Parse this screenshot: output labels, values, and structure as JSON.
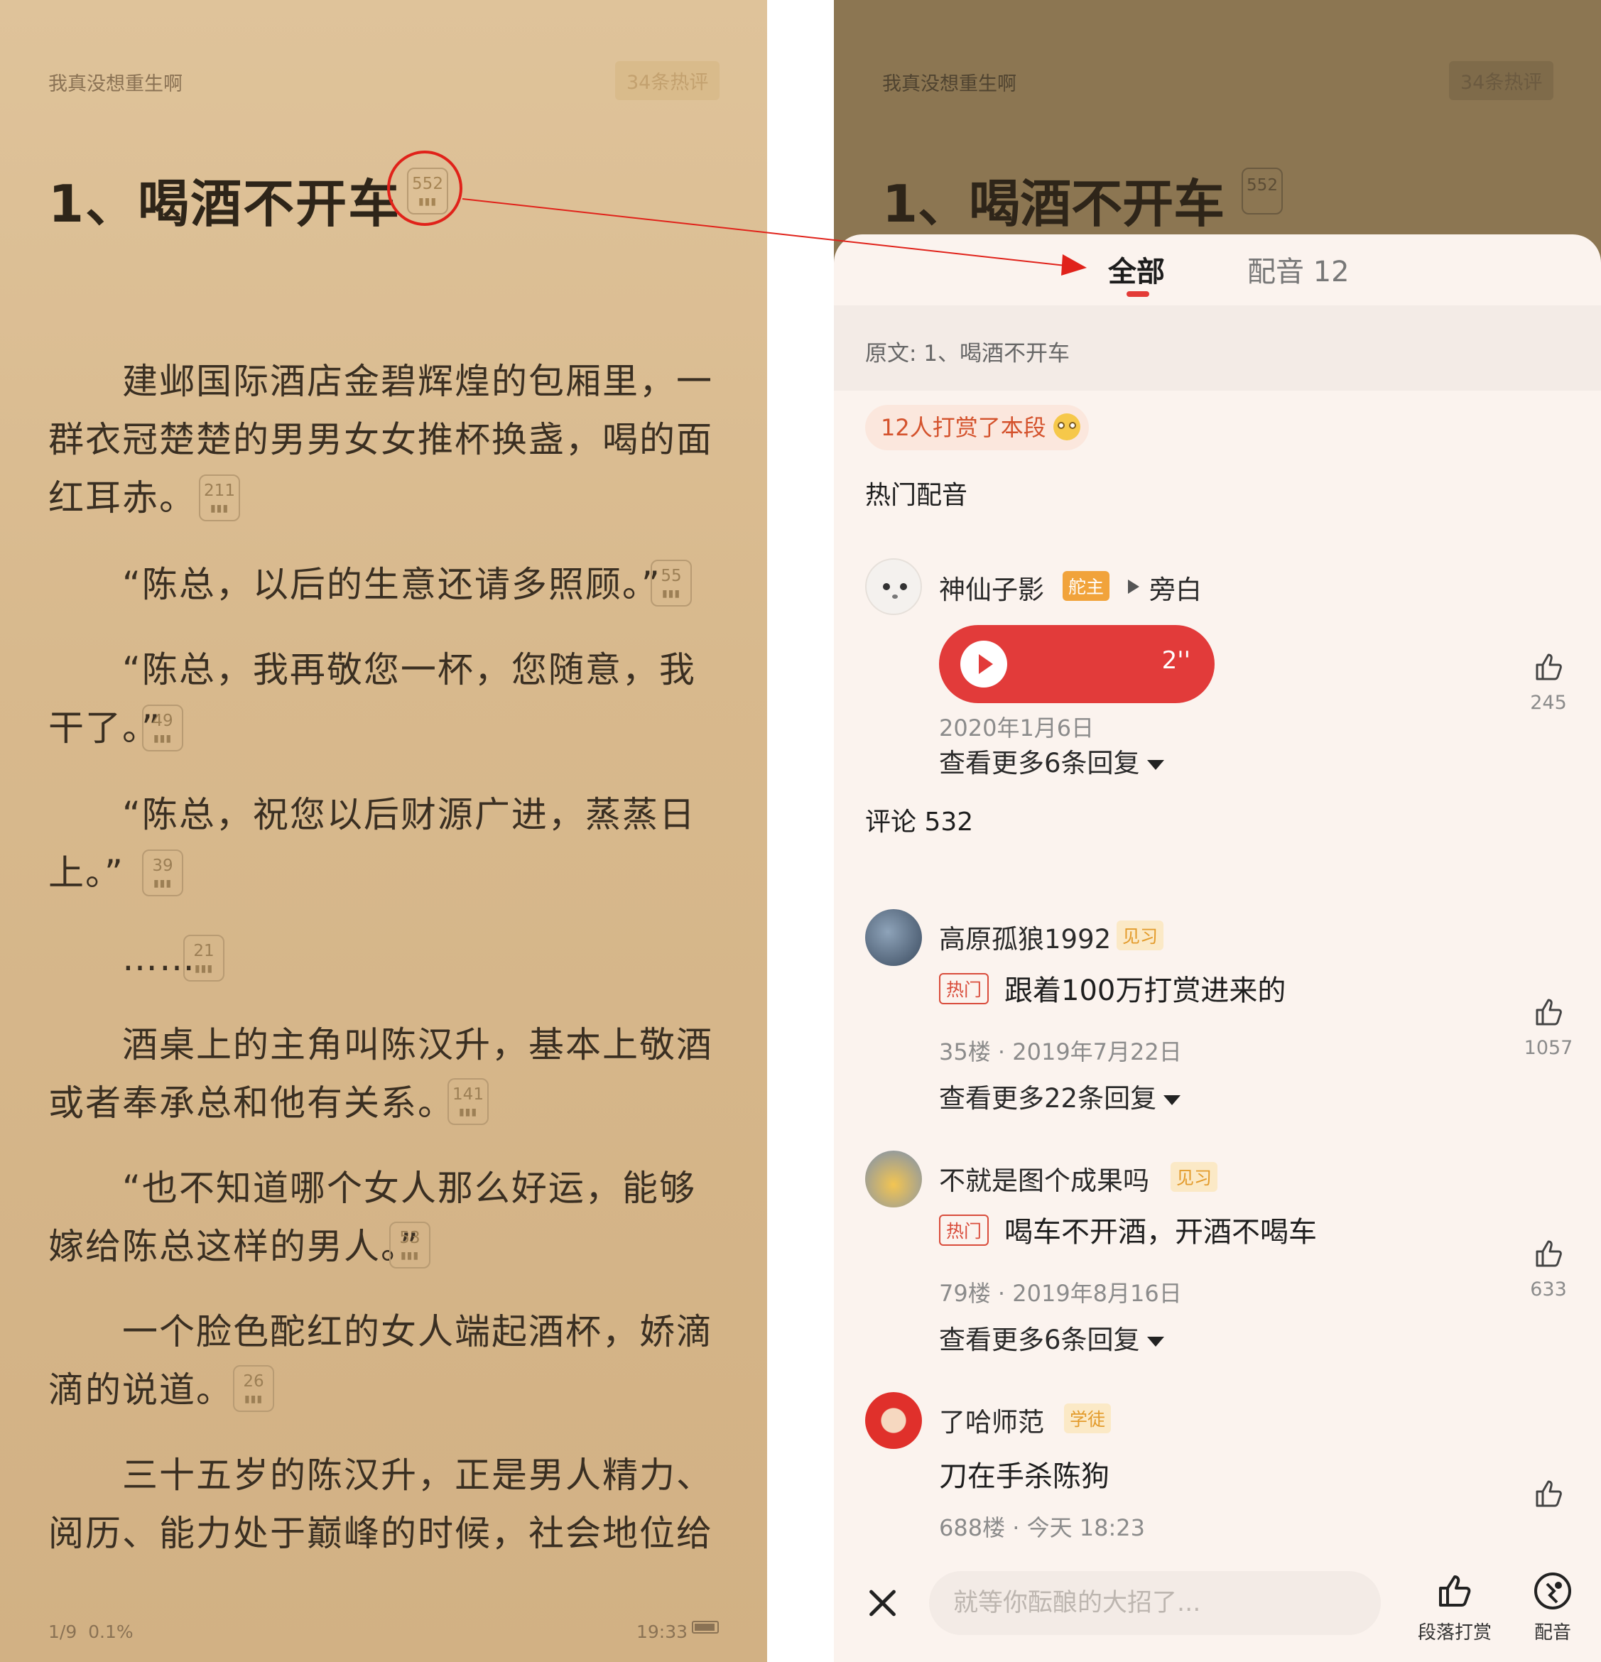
{
  "left": {
    "book_title": "我真没想重生啊",
    "hot_comments": "34条热评",
    "chapter_title": "1、喝酒不开车",
    "chapter_count": "552",
    "paragraphs": [
      {
        "text": "建邺国际酒店金碧辉煌的包厢里，一群衣冠楚楚的男男女女推杯换盏，喝的面红耳赤。",
        "count": "211"
      },
      {
        "text": "“陈总，以后的生意还请多照顾。”",
        "count": "55"
      },
      {
        "text": "“陈总，我再敬您一杯，您随意，我干了。”",
        "count": "49"
      },
      {
        "text": "“陈总，祝您以后财源广进，蒸蒸日上。”",
        "count": "39"
      },
      {
        "text": "……",
        "count": "21"
      },
      {
        "text": "酒桌上的主角叫陈汉升，基本上敬酒或者奉承总和他有关系。",
        "count": "141"
      },
      {
        "text": "“也不知道哪个女人那么好运，能够嫁给陈总这样的男人。”",
        "count": "53"
      },
      {
        "text": "一个脸色酡红的女人端起酒杯，娇滴滴的说道。",
        "count": "26"
      },
      {
        "text": "三十五岁的陈汉升，正是男人精力、阅历、能力处于巅峰的时候，社会地位给",
        "count": ""
      }
    ],
    "page": "1/9",
    "progress": "0.1%",
    "time": "19:33"
  },
  "right": {
    "book_title": "我真没想重生啊",
    "hot_comments": "34条热评",
    "chapter_title": "1、喝酒不开车",
    "chapter_count": "552",
    "tabs": {
      "all": "全部",
      "dub": "配音 12"
    },
    "original": "原文: 1、喝酒不开车",
    "reward": "12人打赏了本段",
    "hot_dub_heading": "热门配音",
    "dub": {
      "user": "神仙子影",
      "tag": "舵主",
      "role": "旁白",
      "duration": "2''",
      "date": "2020年1月6日",
      "more": "查看更多6条回复",
      "likes": "245"
    },
    "comments_heading": "评论 532",
    "comments": [
      {
        "user": "高原孤狼1992",
        "level": "见习",
        "hot": "热门",
        "text": "跟着100万打赏进来的",
        "meta": "35楼 · 2019年7月22日",
        "more": "查看更多22条回复",
        "likes": "1057"
      },
      {
        "user": "不就是图个成果吗",
        "level": "见习",
        "hot": "热门",
        "text": "喝车不开酒，开酒不喝车",
        "meta": "79楼 · 2019年8月16日",
        "more": "查看更多6条回复",
        "likes": "633"
      },
      {
        "user": "了哈师范",
        "level": "学徒",
        "hot": "",
        "text": "刀在手杀陈狗",
        "meta": "688楼 · 今天 18:23",
        "more": "",
        "likes": ""
      }
    ],
    "input_placeholder": "就等你酝酿的大招了...",
    "reward_button": "段落打赏",
    "dub_button": "配音"
  },
  "colors": {
    "accent_red": "#e23b3a",
    "host_tag": "#f1a33b",
    "level_tag": "#e39b2b",
    "paper": "#d8b98d"
  }
}
